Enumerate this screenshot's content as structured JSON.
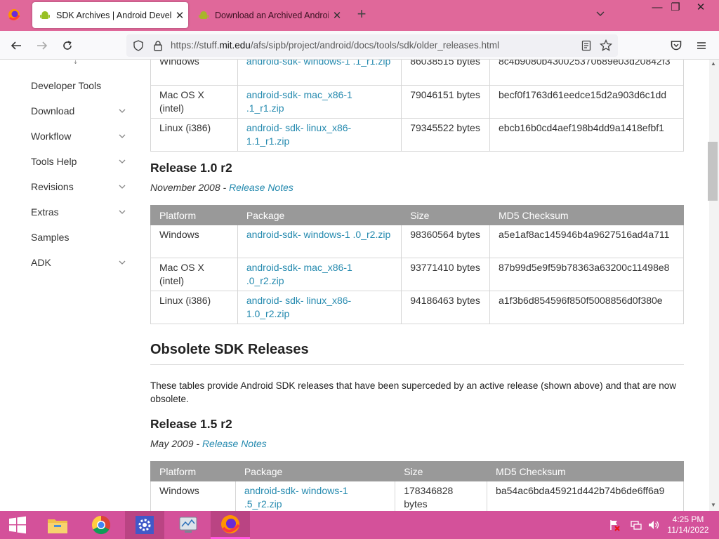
{
  "browser": {
    "tabs": [
      {
        "title": "SDK Archives | Android Develop",
        "active": true
      },
      {
        "title": "Download an Archived Android",
        "active": false
      }
    ],
    "url_prefix": "https://stuff.",
    "url_domain": "mit.edu",
    "url_rest": "/afs/sipb/project/android/docs/tools/sdk/older_releases.html"
  },
  "sidenav": {
    "items": [
      {
        "label": "Developer Tools",
        "chevron": false
      },
      {
        "label": "Download",
        "chevron": true
      },
      {
        "label": "Workflow",
        "chevron": true
      },
      {
        "label": "Tools Help",
        "chevron": true
      },
      {
        "label": "Revisions",
        "chevron": true
      },
      {
        "label": "Extras",
        "chevron": true
      },
      {
        "label": "Samples",
        "chevron": false
      },
      {
        "label": "ADK",
        "chevron": true
      }
    ]
  },
  "top_table": {
    "rows": [
      {
        "platform": "Windows",
        "package": "android-sdk- windows-1 .1_r1.zip",
        "size": "86038515 bytes",
        "md5": "8c4b9080b430025370689e03d20842f3"
      },
      {
        "platform": "Mac OS X (intel)",
        "package": "android-sdk- mac_x86-1 .1_r1.zip",
        "size": "79046151 bytes",
        "md5": "becf0f1763d61eedce15d2a903d6c1dd"
      },
      {
        "platform": "Linux (i386)",
        "package": "android- sdk- linux_x86-1.1_r1.zip",
        "size": "79345522 bytes",
        "md5": "ebcb16b0cd4aef198b4dd9a1418efbf1"
      }
    ]
  },
  "release_10": {
    "heading": "Release 1.0 r2",
    "date": "November 2008 - ",
    "notes_link": "Release Notes",
    "headers": [
      "Platform",
      "Package",
      "Size",
      "MD5 Checksum"
    ],
    "rows": [
      {
        "platform": "Windows",
        "package": "android-sdk- windows-1 .0_r2.zip",
        "size": "98360564 bytes",
        "md5": "a5e1af8ac145946b4a9627516ad4a711"
      },
      {
        "platform": "Mac OS X (intel)",
        "package": "android-sdk- mac_x86-1 .0_r2.zip",
        "size": "93771410 bytes",
        "md5": "87b99d5e9f59b78363a63200c11498e8"
      },
      {
        "platform": "Linux (i386)",
        "package": "android- sdk- linux_x86-1.0_r2.zip",
        "size": "94186463 bytes",
        "md5": "a1f3b6d854596f850f5008856d0f380e"
      }
    ]
  },
  "obsolete": {
    "heading": "Obsolete SDK Releases",
    "paragraph": "These tables provide Android SDK releases that have been superceded by an active release (shown above) and that are now obsolete."
  },
  "release_15": {
    "heading": "Release 1.5 r2",
    "date": "May 2009 - ",
    "notes_link": "Release Notes",
    "headers": [
      "Platform",
      "Package",
      "Size",
      "MD5 Checksum"
    ],
    "rows": [
      {
        "platform": "Windows",
        "package": "android-sdk- windows-1 .5_r2.zip",
        "size": "178346828 bytes",
        "md5": "ba54ac6bda45921d442b74b6de6ff6a9"
      }
    ]
  },
  "taskbar": {
    "time": "4:25 PM",
    "date": "11/14/2022"
  },
  "colors": {
    "tabstrip": "#e0689a",
    "taskbar": "#d4519a",
    "link": "#258aaf",
    "table_header": "#999999"
  }
}
